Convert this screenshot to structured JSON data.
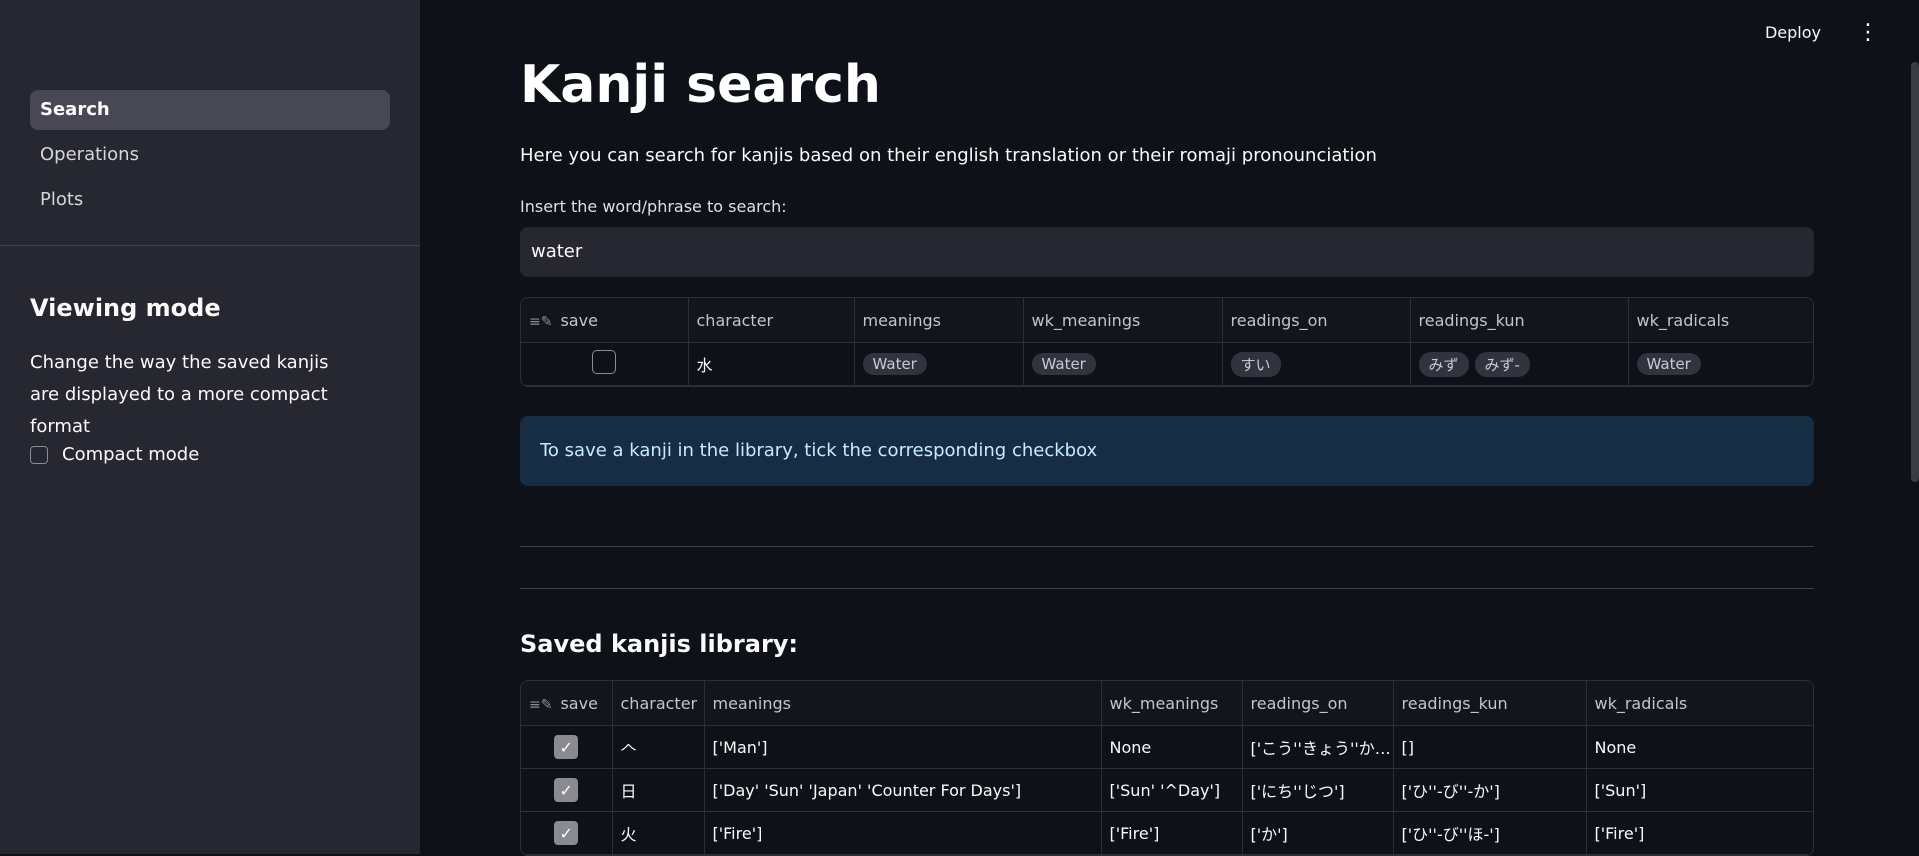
{
  "sidebar": {
    "nav": [
      "Search",
      "Operations",
      "Plots"
    ],
    "viewing_title": "Viewing mode",
    "viewing_desc": "Change the way the saved kanjis are displayed to a more compact format",
    "compact_label": "Compact mode"
  },
  "topbar": {
    "deploy": "Deploy",
    "menu_icon": "⋮"
  },
  "main": {
    "title": "Kanji search",
    "subtitle": "Here you can search for kanjis based on their english translation or their romaji pronounciation",
    "input_label": "Insert the word/phrase to search:",
    "input_value": "water",
    "info": "To save a kanji in the library, tick the corresponding checkbox",
    "library_title": "Saved kanjis library:"
  },
  "search_table": {
    "columns": [
      "save",
      "character",
      "meanings",
      "wk_meanings",
      "readings_on",
      "readings_kun",
      "wk_radicals"
    ],
    "rows": [
      {
        "character": "水",
        "meanings": [
          "Water"
        ],
        "wk_meanings": [
          "Water"
        ],
        "readings_on": [
          "すい"
        ],
        "readings_kun": [
          "みず",
          "みず-"
        ],
        "wk_radicals": [
          "Water"
        ]
      }
    ]
  },
  "library_table": {
    "columns": [
      "save",
      "character",
      "meanings",
      "wk_meanings",
      "readings_on",
      "readings_kun",
      "wk_radicals"
    ],
    "rows": [
      {
        "character": "𠆢",
        "meanings": "['Man']",
        "wk_meanings": "None",
        "readings_on": "['こう''きょう''か…",
        "readings_kun": "[]",
        "wk_radicals": "None"
      },
      {
        "character": "日",
        "meanings": "['Day' 'Sun' 'Japan' 'Counter For Days']",
        "wk_meanings": "['Sun' '^Day']",
        "readings_on": "['にち''じつ']",
        "readings_kun": "['ひ''-び''-か']",
        "wk_radicals": "['Sun']"
      },
      {
        "character": "火",
        "meanings": "['Fire']",
        "wk_meanings": "['Fire']",
        "readings_on": "['か']",
        "readings_kun": "['ひ''-び''ほ-']",
        "wk_radicals": "['Fire']"
      }
    ]
  }
}
